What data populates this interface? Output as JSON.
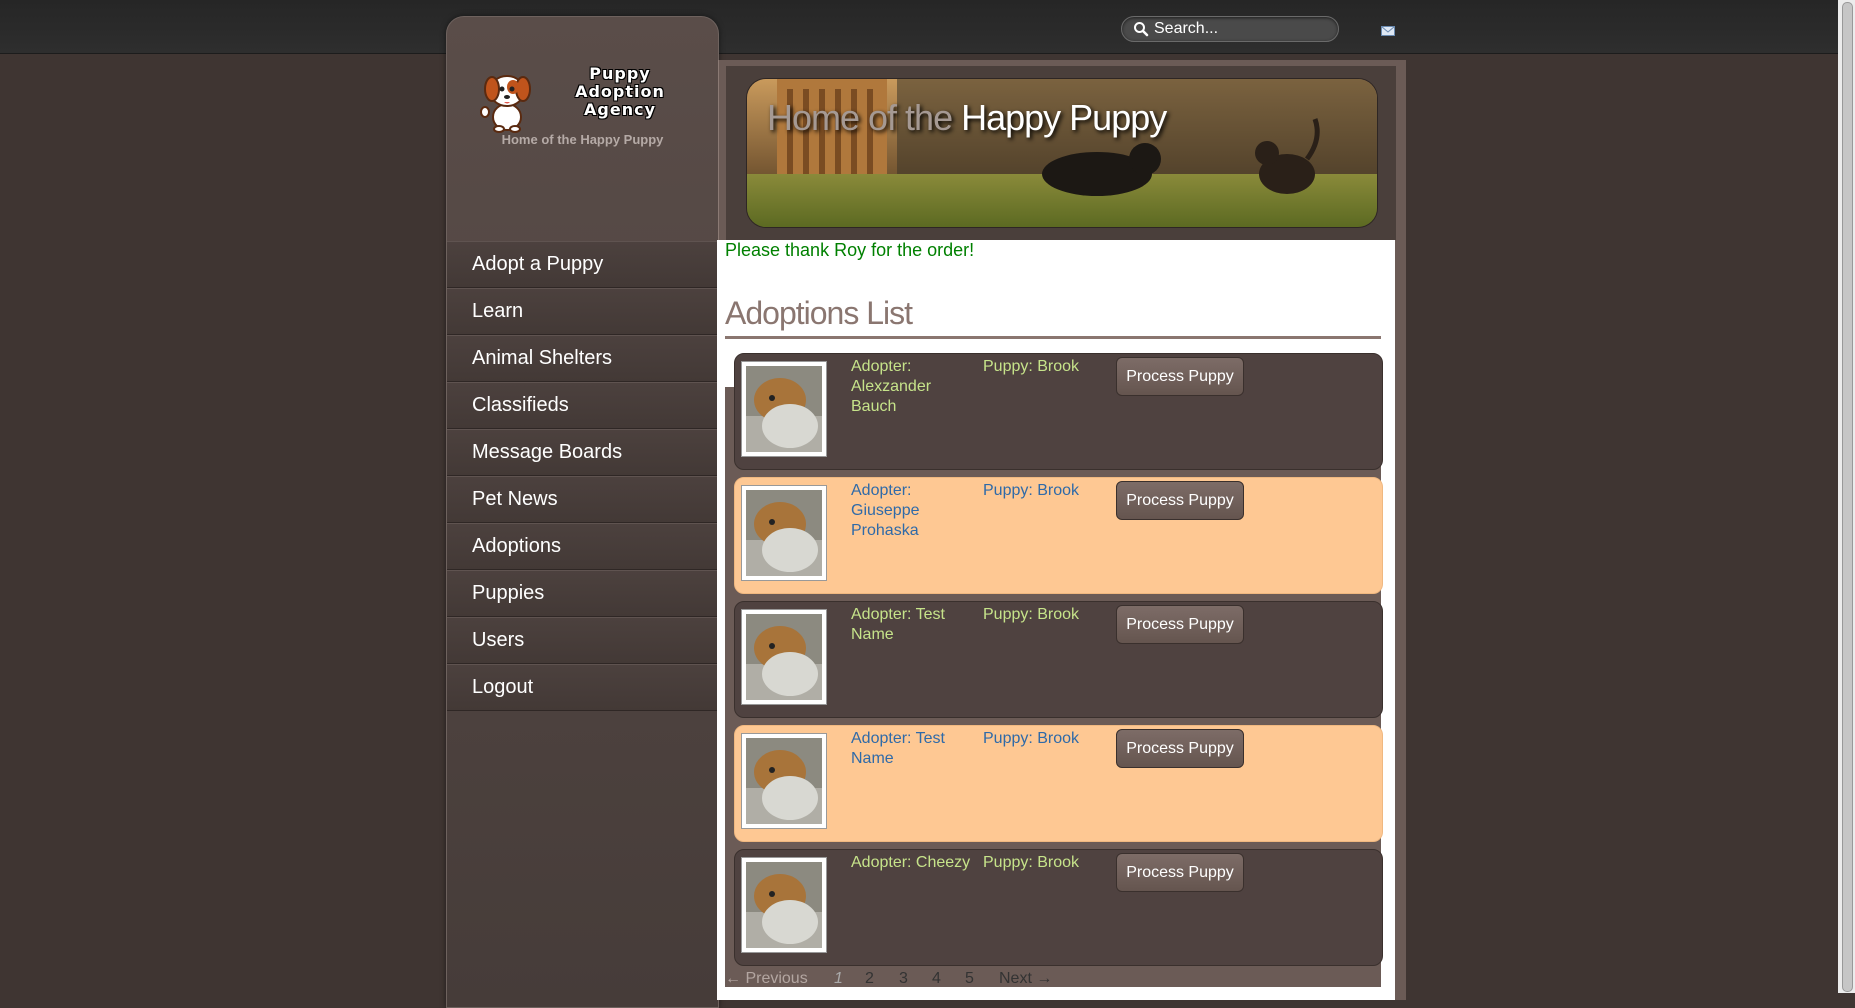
{
  "topbar": {
    "search_placeholder": "Search..."
  },
  "sidebar": {
    "logo_lines": [
      "Puppy",
      "Adoption",
      "Agency"
    ],
    "tagline": "Home of the Happy Puppy",
    "nav": [
      {
        "label": "Adopt a Puppy"
      },
      {
        "label": "Learn"
      },
      {
        "label": "Animal Shelters"
      },
      {
        "label": "Classifieds"
      },
      {
        "label": "Message Boards"
      },
      {
        "label": "Pet News"
      },
      {
        "label": "Adoptions"
      },
      {
        "label": "Puppies"
      },
      {
        "label": "Users"
      },
      {
        "label": "Logout"
      }
    ]
  },
  "banner": {
    "title_part1": "Home of the ",
    "title_part2": "Happy Puppy"
  },
  "main": {
    "flash": "Please thank Roy for the order!",
    "title": "Adoptions List",
    "rows": [
      {
        "adopter": "Adopter: Alexzander Bauch",
        "puppy": "Puppy: Brook",
        "button": "Process Puppy"
      },
      {
        "adopter": "Adopter: Giuseppe Prohaska",
        "puppy": "Puppy: Brook",
        "button": "Process Puppy"
      },
      {
        "adopter": "Adopter: Test Name",
        "puppy": "Puppy: Brook",
        "button": "Process Puppy"
      },
      {
        "adopter": "Adopter: Test Name",
        "puppy": "Puppy: Brook",
        "button": "Process Puppy"
      },
      {
        "adopter": "Adopter: Cheezy",
        "puppy": "Puppy: Brook",
        "button": "Process Puppy"
      }
    ],
    "pagination": {
      "previous": "← Previous",
      "pages": [
        "1",
        "2",
        "3",
        "4",
        "5"
      ],
      "next": "Next →"
    }
  }
}
